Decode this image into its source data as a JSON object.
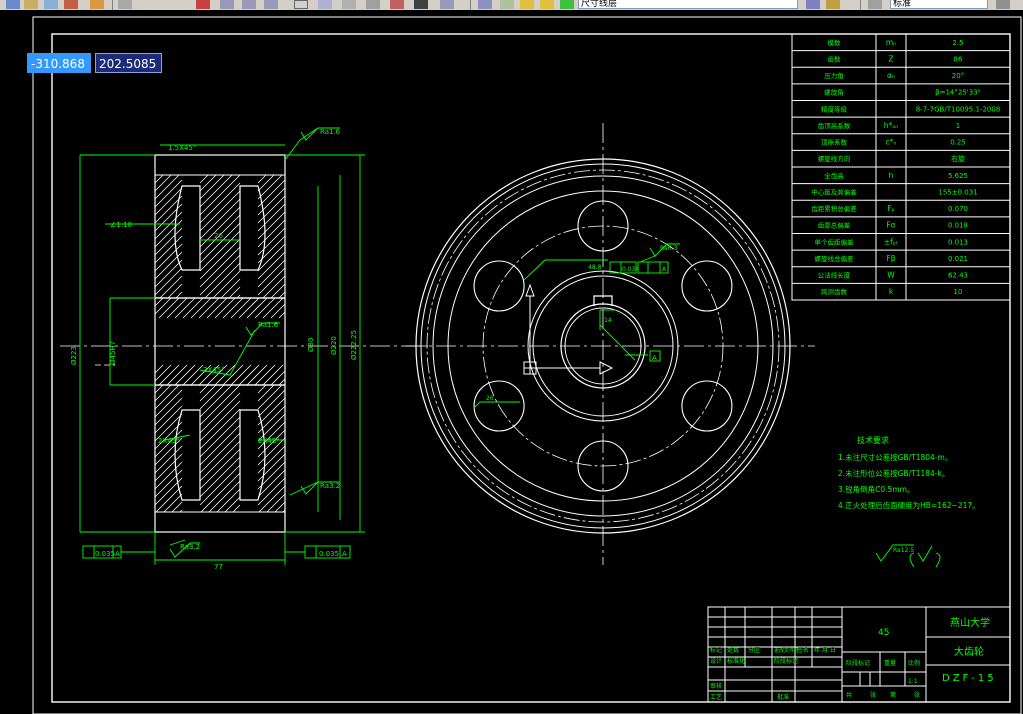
{
  "toolbar": {
    "layer_combo": "尺寸线层",
    "style_combo": "标准"
  },
  "cursor_input": {
    "x": "-310.868",
    "y": "202.5085"
  },
  "param_table": [
    {
      "name": "模数",
      "sym": "mₙ",
      "val": "2.5"
    },
    {
      "name": "齿数",
      "sym": "Z",
      "val": "86"
    },
    {
      "name": "压力角",
      "sym": "αₙ",
      "val": "20°"
    },
    {
      "name": "螺旋角",
      "sym": "",
      "val": "β=14°25'33\""
    },
    {
      "name": "精度等级",
      "sym": "",
      "val": "8-7-7GB/T10095.1-2008"
    },
    {
      "name": "齿顶高系数",
      "sym": "h*ₐₙ",
      "val": "1"
    },
    {
      "name": "顶隙系数",
      "sym": "c*ₙ",
      "val": "0.25"
    },
    {
      "name": "螺旋线方向",
      "sym": "",
      "val": "右旋"
    },
    {
      "name": "全齿高",
      "sym": "h",
      "val": "5.625"
    },
    {
      "name": "中心距及其偏差",
      "sym": "",
      "val": "155±0.031"
    },
    {
      "name": "齿距累积总偏差",
      "sym": "Fₚ",
      "val": "0.070"
    },
    {
      "name": "齿廓总偏差",
      "sym": "Fα",
      "val": "0.018"
    },
    {
      "name": "单个齿距偏差",
      "sym": "±fₚₜ",
      "val": "0.013"
    },
    {
      "name": "螺旋线总偏差",
      "sym": "Fβ",
      "val": "0.021"
    },
    {
      "name": "公法线长度",
      "sym": "W",
      "val": "62.43"
    },
    {
      "name": "跨测齿数",
      "sym": "k",
      "val": "10"
    }
  ],
  "notes": {
    "title": "技术要求",
    "lines": [
      "1.未注尺寸公差按GB/T1804-m。",
      "2.未注形位公差按GB/T1184-k。",
      "3.锐角倒角C0.5mm。",
      "4.正火处理后齿面硬度为HB=162~217。"
    ]
  },
  "dims": {
    "chamfer_top": "1.5X45°",
    "ra_top": "Ra1.6",
    "draft": "∠1:10",
    "hole_w": "26",
    "chamfer_mid": "2X45°",
    "chamfer_bl": "2X45°",
    "chamfer_br": "2X45°",
    "ra_mid": "Ra1.6",
    "ra_bot": "Ra3.2",
    "ra_bore": "Ra3.2",
    "bore_d": "Ø45H7",
    "d1": "Ø80",
    "d2": "Ø220",
    "d3": "Ø223",
    "d4": "Ø222.25",
    "face_w": "77",
    "tol_left": "0.035",
    "tol_right": "0.035",
    "key_tol": "0.034",
    "key_dim": "48.8",
    "key_w": "14",
    "hole_ra": "Ra6.3",
    "datum": "A",
    "rough_sym": "Ra12.5"
  },
  "title_block": {
    "school": "燕山大学",
    "part_name": "大齿轮",
    "drawing_no": "DZF-15",
    "material": "45",
    "scale": "1:1",
    "headers": [
      "标记",
      "处数",
      "分区",
      "更改文件号",
      "签名",
      "年.月.日"
    ],
    "row2": [
      "设计",
      "标准化",
      "阶段标记",
      "重量",
      "比例"
    ],
    "row_review": "审核",
    "row_craft": "工艺",
    "row_approve": "批准",
    "sheet": [
      "共",
      "张",
      "第",
      "张"
    ]
  },
  "colors": {
    "line": "#ffffff",
    "dim": "#00ff00",
    "hatch": "#ffffff",
    "center": "#ffffff"
  }
}
